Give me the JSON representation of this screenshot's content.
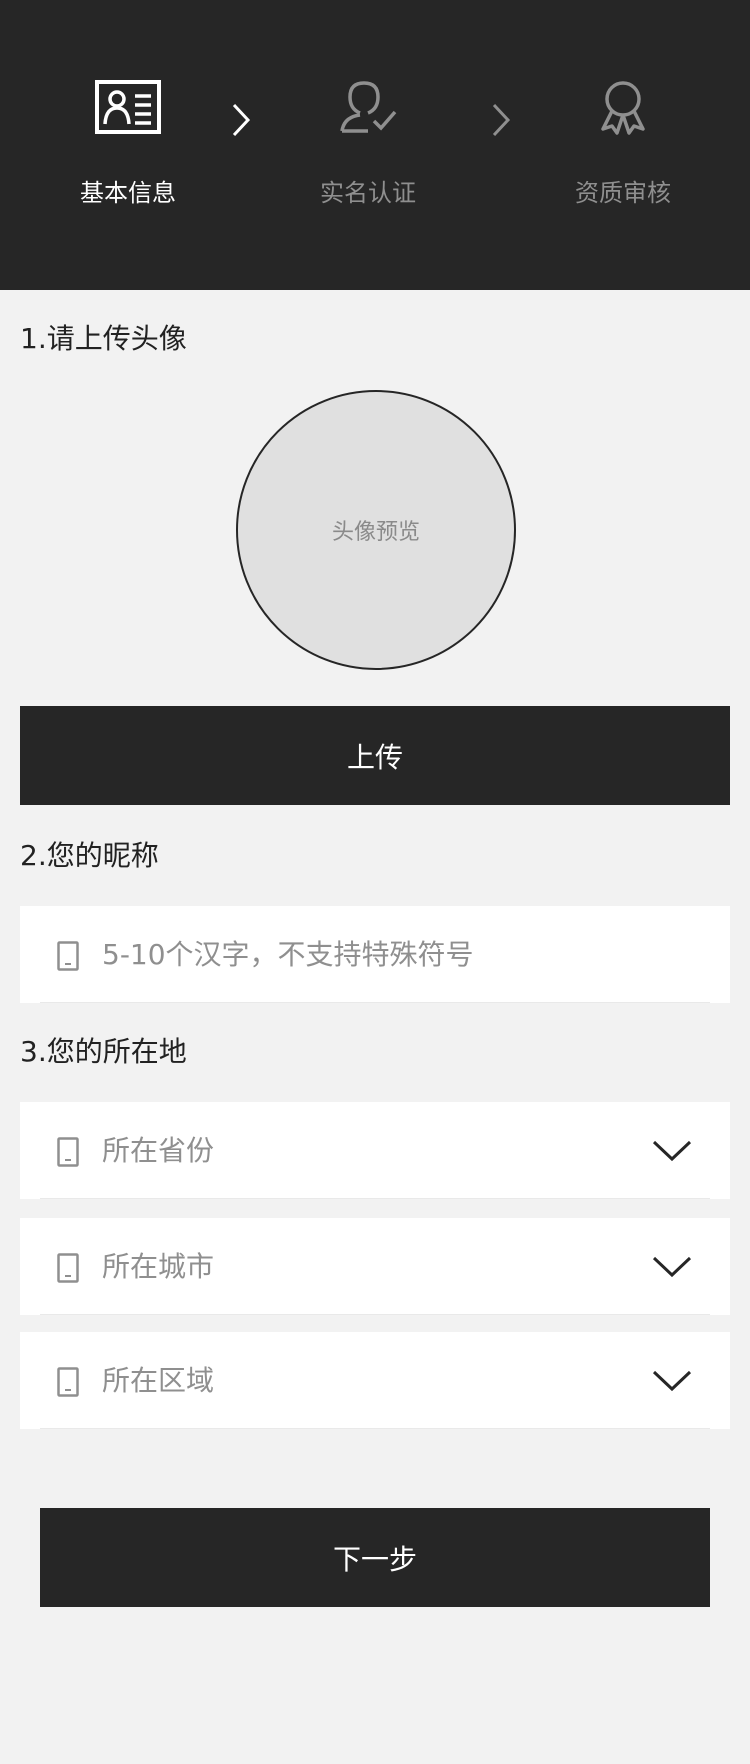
{
  "steps": [
    {
      "label": "基本信息",
      "icon": "id-card-icon",
      "active": true
    },
    {
      "label": "实名认证",
      "icon": "user-verified-icon",
      "active": false
    },
    {
      "label": "资质审核",
      "icon": "award-ribbon-icon",
      "active": false
    }
  ],
  "avatar_section": {
    "title": "1.请上传头像",
    "preview_text": "头像预览",
    "upload_label": "上传"
  },
  "nickname_section": {
    "title": "2.您的昵称",
    "placeholder": "5-10个汉字，不支持特殊符号"
  },
  "location_section": {
    "title": "3.您的所在地",
    "province_placeholder": "所在省份",
    "city_placeholder": "所在城市",
    "district_placeholder": "所在区域"
  },
  "next_label": "下一步",
  "colors": {
    "header_bg": "#262626",
    "page_bg": "#f2f2f2",
    "active_step": "#ffffff",
    "inactive_step": "#8f8f8f",
    "button_bg": "#262626",
    "placeholder": "#8f8f8f"
  }
}
